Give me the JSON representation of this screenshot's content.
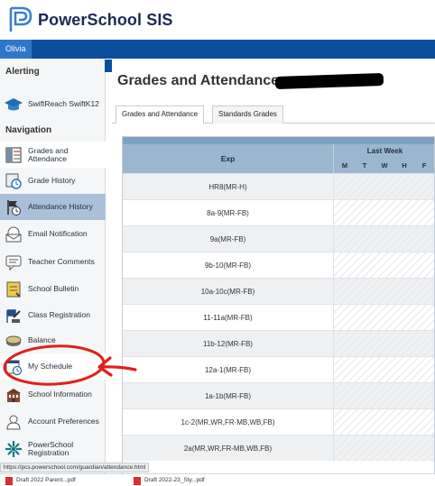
{
  "app": {
    "title": "PowerSchool SIS",
    "user": "Olivia"
  },
  "sidebar": {
    "alerting_header": "Alerting",
    "alerting_item": "SwiftReach SwiftK12",
    "navigation_header": "Navigation",
    "items": [
      {
        "label": "Grades and Attendance",
        "icon": "gradebook-icon"
      },
      {
        "label": "Grade History",
        "icon": "history-clock-icon"
      },
      {
        "label": "Attendance History",
        "icon": "attendance-flag-icon"
      },
      {
        "label": "Email Notification",
        "icon": "envelope-icon"
      },
      {
        "label": "Teacher Comments",
        "icon": "comment-icon"
      },
      {
        "label": "School Bulletin",
        "icon": "bulletin-icon"
      },
      {
        "label": "Class Registration",
        "icon": "registration-icon"
      },
      {
        "label": "Balance",
        "icon": "coin-icon"
      },
      {
        "label": "My Schedule",
        "icon": "calendar-icon"
      },
      {
        "label": "School Information",
        "icon": "school-icon"
      },
      {
        "label": "Account Preferences",
        "icon": "account-icon"
      },
      {
        "label": "PowerSchool Registration",
        "icon": "registration-star-icon"
      }
    ]
  },
  "main": {
    "page_title": "Grades and Attendance:",
    "tabs": [
      "Grades and Attendance",
      "Standards Grades"
    ],
    "table": {
      "col_exp": "Exp",
      "col_week": "Last Week",
      "days": [
        "M",
        "T",
        "W",
        "H",
        "F"
      ],
      "rows": [
        "HR8(MR-H)",
        "8a-9(MR-FB)",
        "9a(MR-FB)",
        "9b-10(MR-FB)",
        "10a-10c(MR-FB)",
        "11-11a(MR-FB)",
        "11b-12(MR-FB)",
        "12a-1(MR-FB)",
        "1a-1b(MR-FB)",
        "1c-2(MR,WR,FR-MB,WB,FB)",
        "2a(MR,WR,FR-MB,WB,FB)"
      ]
    }
  },
  "status_bar": {
    "url": "https://pcs.powerschool.com/guardian/attendance.html"
  },
  "downloads": [
    {
      "name": "Draft 2022 Parent...pdf"
    },
    {
      "name": "Draft 2022-23_Sty...pdf"
    }
  ],
  "colors": {
    "brand_blue": "#0b4f9c",
    "active_nav": "#a9c0d8",
    "table_header": "#9bb7d0",
    "annotation_red": "#e0201b"
  }
}
